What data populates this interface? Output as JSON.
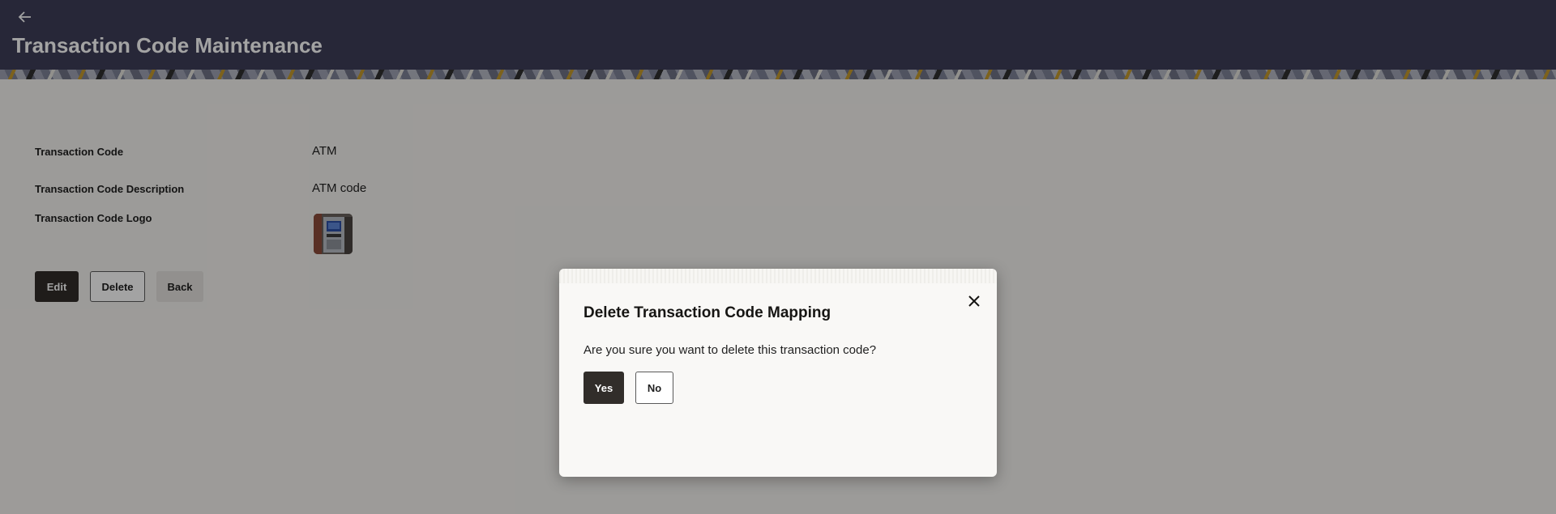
{
  "header": {
    "back_icon": "arrow-left-icon",
    "title": "Transaction Code Maintenance"
  },
  "details": {
    "fields": [
      {
        "label": "Transaction Code",
        "value": "ATM"
      },
      {
        "label": "Transaction Code Description",
        "value": "ATM code"
      },
      {
        "label": "Transaction Code Logo",
        "image": "atm-machine-image"
      }
    ]
  },
  "actions": {
    "edit_label": "Edit",
    "delete_label": "Delete",
    "back_label": "Back"
  },
  "dialog": {
    "title": "Delete Transaction Code Mapping",
    "message": "Are you sure you want to delete this transaction code?",
    "yes_label": "Yes",
    "no_label": "No",
    "close_icon": "close-icon"
  },
  "colors": {
    "header_bg": "#3d3e58",
    "primary_button": "#312d2a",
    "page_bg": "#f5f3f0"
  }
}
